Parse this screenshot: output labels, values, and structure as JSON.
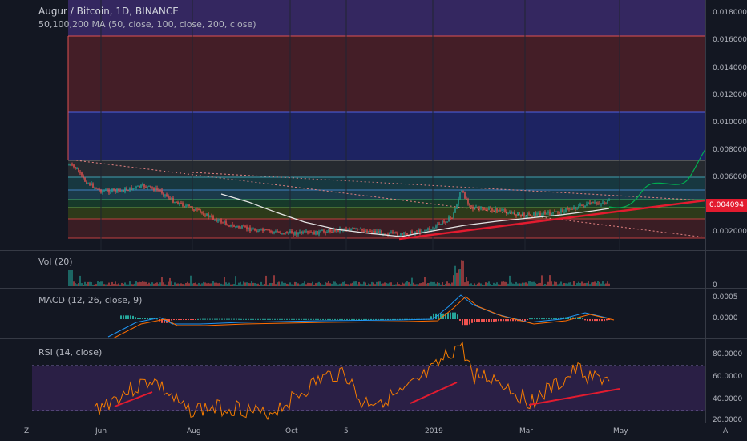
{
  "header": {
    "symbol": "Augur / Bitcoin, 1D, BINANCE",
    "ma_label": "50,100,200 MA (50, close, 100, close, 200, close)"
  },
  "price_axis": {
    "ticks": [
      "0.018000",
      "0.016000",
      "0.014000",
      "0.012000",
      "0.010000",
      "0.008000",
      "0.006000",
      "0.002000"
    ],
    "current_price": "0.004094"
  },
  "volume_pane": {
    "label": "Vol (20)",
    "tick": "0"
  },
  "macd_pane": {
    "label": "MACD (12, 26, close, 9)",
    "ticks": [
      "0.0005",
      "0.0000"
    ]
  },
  "rsi_pane": {
    "label": "RSI (14, close)",
    "ticks": [
      "80.0000",
      "60.0000",
      "40.0000",
      "20.0000"
    ]
  },
  "time_axis": {
    "ticks": [
      "Jun",
      "Aug",
      "Oct",
      "5",
      "2019",
      "Mar",
      "May"
    ]
  },
  "corner": {
    "left_icon": "Z",
    "right_icon": "A"
  },
  "colors": {
    "background": "#131722",
    "up": "#26a69a",
    "down": "#ef5350",
    "trendline": "#e31b2f",
    "current_price": "#e31b2f",
    "rsi": "#f57c00",
    "macd": "#2196f3",
    "signal": "#ff6d00",
    "projection": "#00b050"
  }
}
